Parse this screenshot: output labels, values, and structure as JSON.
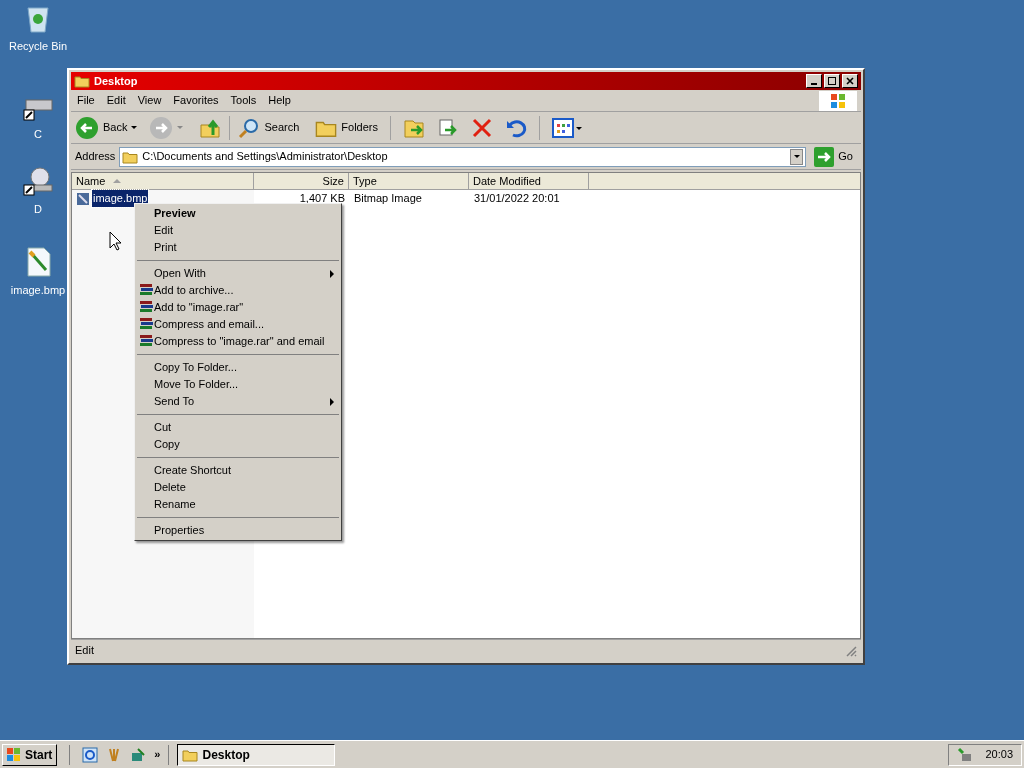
{
  "desktop_icons": [
    {
      "kind": "recycle",
      "label": "Recycle Bin"
    },
    {
      "kind": "drive",
      "label": "C"
    },
    {
      "kind": "cdrom",
      "label": "D"
    },
    {
      "kind": "image",
      "label": "image.bmp"
    }
  ],
  "window": {
    "title": "Desktop",
    "menu": [
      "File",
      "Edit",
      "View",
      "Favorites",
      "Tools",
      "Help"
    ],
    "toolbar": {
      "back": "Back",
      "search": "Search",
      "folders": "Folders"
    },
    "address": {
      "label": "Address",
      "value": "C:\\Documents and Settings\\Administrator\\Desktop",
      "go": "Go"
    },
    "table": {
      "columns": [
        {
          "label": "Name",
          "sorted": true
        },
        {
          "label": "Size",
          "sorted": false
        },
        {
          "label": "Type",
          "sorted": false
        },
        {
          "label": "Date Modified",
          "sorted": false
        }
      ],
      "rows": [
        {
          "name": "image.bmp",
          "size": "1,407 KB",
          "type": "Bitmap Image",
          "modified": "31/01/2022 20:01",
          "selected": true
        }
      ]
    },
    "status_bar": "Edit"
  },
  "context_menu": [
    [
      {
        "kind": "default",
        "label": "Preview"
      },
      {
        "kind": "plain",
        "label": "Edit"
      },
      {
        "kind": "plain",
        "label": "Print"
      }
    ],
    [
      {
        "kind": "submenu",
        "label": "Open With"
      },
      {
        "kind": "rar",
        "label": "Add to archive..."
      },
      {
        "kind": "rar",
        "label": "Add to \"image.rar\""
      },
      {
        "kind": "rar",
        "label": "Compress and email..."
      },
      {
        "kind": "rar",
        "label": "Compress to \"image.rar\" and email"
      }
    ],
    [
      {
        "kind": "plain",
        "label": "Copy To Folder..."
      },
      {
        "kind": "plain",
        "label": "Move To Folder..."
      },
      {
        "kind": "submenu",
        "label": "Send To"
      }
    ],
    [
      {
        "kind": "plain",
        "label": "Cut"
      },
      {
        "kind": "plain",
        "label": "Copy"
      }
    ],
    [
      {
        "kind": "plain",
        "label": "Create Shortcut"
      },
      {
        "kind": "plain",
        "label": "Delete"
      },
      {
        "kind": "plain",
        "label": "Rename"
      }
    ],
    [
      {
        "kind": "plain",
        "label": "Properties"
      }
    ]
  ],
  "taskbar": {
    "start": "Start",
    "more": "»",
    "task": "Desktop",
    "clock": "20:03"
  }
}
